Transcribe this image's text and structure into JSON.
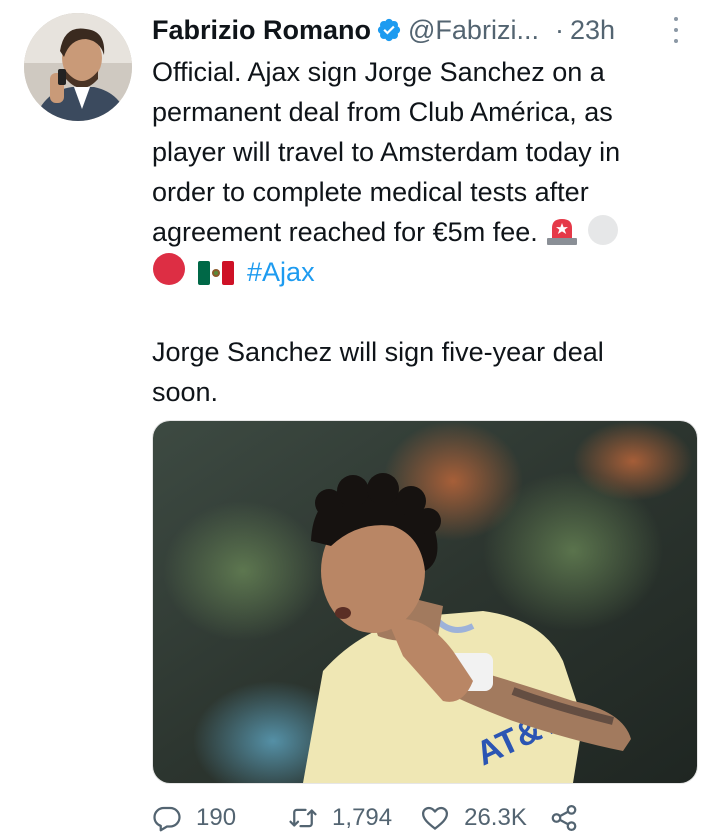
{
  "tweet": {
    "author_name": "Fabrizio Romano",
    "handle": "@Fabrizi...",
    "separator": "·",
    "time": "23h",
    "text_lines": [
      "Official. Ajax sign Jorge Sanchez on a",
      "permanent deal from Club América, as",
      "player will travel to Amsterdam today in",
      "order to complete medical tests after",
      "agreement reached for €5m fee."
    ],
    "hashtag": "#Ajax",
    "second_paragraph_lines": [
      "Jorge Sanchez will sign five-year deal",
      "soon."
    ],
    "emojis": [
      "siren-emoji",
      "white-circle-emoji",
      "red-circle-emoji",
      "mexico-flag-emoji"
    ]
  },
  "actions": {
    "replies": "190",
    "retweets": "1,794",
    "likes": "26.3K"
  },
  "colors": {
    "link": "#1d9bf0",
    "secondary_text": "#536471",
    "verified": "#1d9bf0"
  }
}
